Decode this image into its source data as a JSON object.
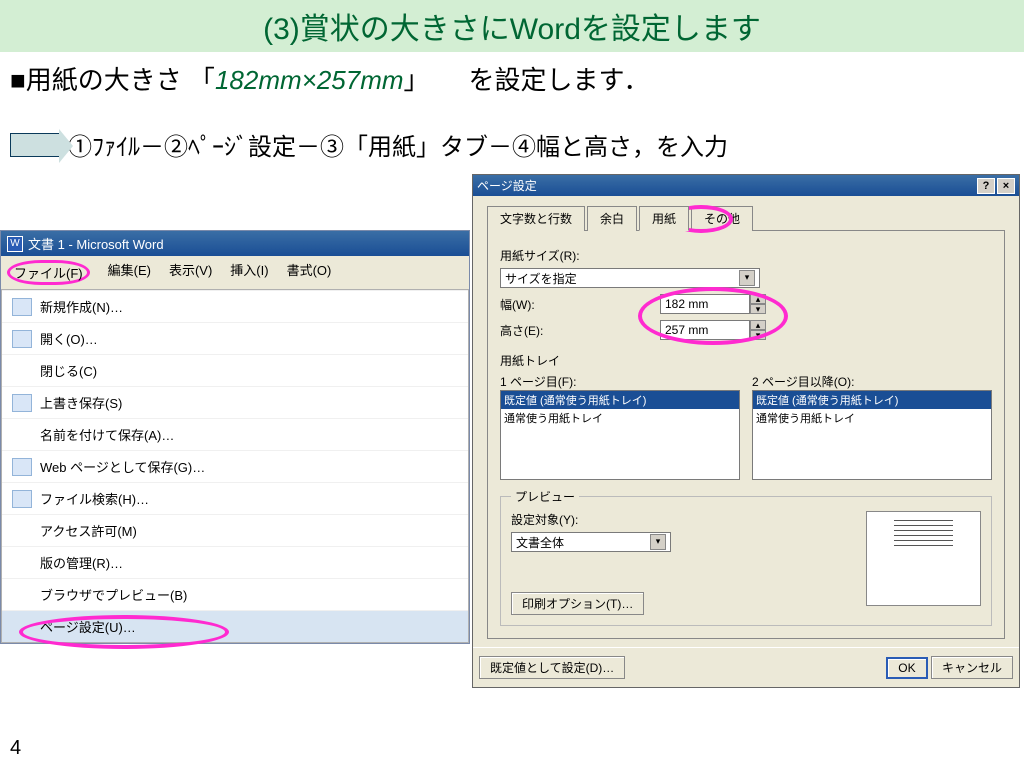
{
  "slide": {
    "title": "(3)賞状の大きさにWordを設定します",
    "line1_a": "■用紙の大きさ 「",
    "line1_size": "182mm×257mm",
    "line1_b": "」　　を設定します．",
    "steps": "①ﾌｧｲﾙ－②ﾍﾟｰｼﾞ設定－③「用紙」タブ－④幅と高さ，を入力",
    "page_number": "4"
  },
  "word": {
    "title": "文書 1 - Microsoft Word",
    "menus": {
      "file": "ファイル(F)",
      "edit": "編集(E)",
      "view": "表示(V)",
      "insert": "挿入(I)",
      "format": "書式(O)"
    },
    "file_menu": [
      "新規作成(N)…",
      "開く(O)…",
      "閉じる(C)",
      "上書き保存(S)",
      "名前を付けて保存(A)…",
      "Web ページとして保存(G)…",
      "ファイル検索(H)…",
      "アクセス許可(M)",
      "版の管理(R)…",
      "ブラウザでプレビュー(B)",
      "ページ設定(U)…"
    ]
  },
  "dialog": {
    "title": "ページ設定",
    "tabs": {
      "chars": "文字数と行数",
      "margins": "余白",
      "paper": "用紙",
      "other": "その他"
    },
    "paper_size_label": "用紙サイズ(R):",
    "paper_size_value": "サイズを指定",
    "width_label": "幅(W):",
    "width_value": "182 mm",
    "height_label": "高さ(E):",
    "height_value": "257 mm",
    "tray_label": "用紙トレイ",
    "tray1_label": "1 ページ目(F):",
    "tray2_label": "2 ページ目以降(O):",
    "tray_default": "既定値 (通常使う用紙トレイ)",
    "tray_normal": "通常使う用紙トレイ",
    "preview_group": "プレビュー",
    "apply_to_label": "設定対象(Y):",
    "apply_to_value": "文書全体",
    "print_options": "印刷オプション(T)…",
    "set_default": "既定値として設定(D)…",
    "ok": "OK",
    "cancel": "キャンセル",
    "help": "?",
    "close": "×"
  }
}
